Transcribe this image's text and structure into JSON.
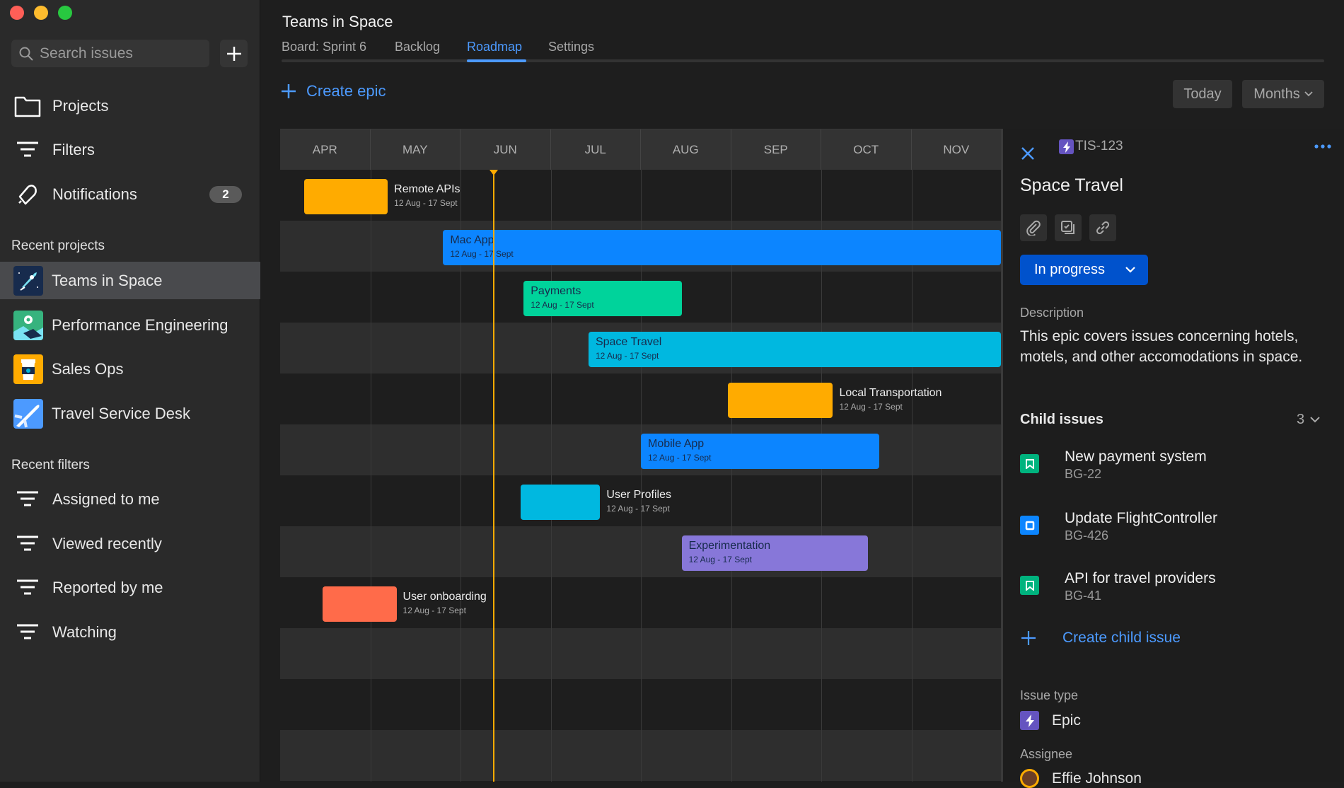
{
  "window": {
    "controls": [
      "close",
      "minimize",
      "maximize"
    ]
  },
  "sidebar": {
    "search_placeholder": "Search issues",
    "nav": [
      {
        "label": "Projects",
        "icon": "folder-icon"
      },
      {
        "label": "Filters",
        "icon": "filter-icon"
      },
      {
        "label": "Notifications",
        "icon": "bell-icon",
        "badge": "2"
      }
    ],
    "recent_projects_heading": "Recent projects",
    "projects": [
      {
        "label": "Teams in Space",
        "color": "#172b4d",
        "selected": true
      },
      {
        "label": "Performance Engineering",
        "color": "#36b37e"
      },
      {
        "label": "Sales Ops",
        "color": "#ffab00"
      },
      {
        "label": "Travel Service Desk",
        "color": "#4c9aff"
      }
    ],
    "recent_filters_heading": "Recent filters",
    "filters": [
      {
        "label": "Assigned to me"
      },
      {
        "label": "Viewed recently"
      },
      {
        "label": "Reported by me"
      },
      {
        "label": "Watching"
      }
    ]
  },
  "header": {
    "title": "Teams in Space",
    "tabs": [
      {
        "label": "Board: Sprint 6"
      },
      {
        "label": "Backlog"
      },
      {
        "label": "Roadmap",
        "active": true
      },
      {
        "label": "Settings"
      }
    ],
    "create_epic": "Create epic",
    "today": "Today",
    "scale": "Months"
  },
  "roadmap": {
    "months": [
      "APR",
      "MAY",
      "JUN",
      "JUL",
      "AUG",
      "SEP",
      "OCT",
      "NOV"
    ],
    "today": "06-12",
    "epics": [
      {
        "name": "Remote APIs",
        "dates": "12 Aug - 17 Sept",
        "start": "04-09",
        "end": "05-07",
        "color": "#ffab00",
        "label_outside": true
      },
      {
        "name": "Mac App",
        "dates": "12 Aug - 17 Sept",
        "start": "05-26",
        "end": "12-31",
        "color": "#0c85ff",
        "label_outside": false
      },
      {
        "name": "Payments",
        "dates": "12 Aug - 17 Sept",
        "start": "06-22",
        "end": "08-15",
        "color": "#00d39b",
        "label_outside": false
      },
      {
        "name": "Space Travel",
        "dates": "12 Aug - 17 Sept",
        "start": "07-14",
        "end": "12-31",
        "color": "#00b8e0",
        "label_outside": false
      },
      {
        "name": "Local Transportation",
        "dates": "12 Aug - 17 Sept",
        "start": "08-31",
        "end": "10-05",
        "color": "#ffab00",
        "label_outside": true
      },
      {
        "name": "Mobile App",
        "dates": "12 Aug - 17 Sept",
        "start": "08-01",
        "end": "10-21",
        "color": "#0c85ff",
        "label_outside": false
      },
      {
        "name": "User Profiles",
        "dates": "12 Aug - 17 Sept",
        "start": "06-21",
        "end": "07-18",
        "color": "#00b8e0",
        "label_outside": true
      },
      {
        "name": "Experimentation",
        "dates": "12 Aug - 17 Sept",
        "start": "08-15",
        "end": "10-17",
        "color": "#8777d9",
        "label_outside": false
      },
      {
        "name": "User onboarding",
        "dates": "12 Aug - 17 Sept",
        "start": "04-15",
        "end": "05-10",
        "color": "#ff6b4a",
        "label_outside": true
      }
    ]
  },
  "panel": {
    "key": "TIS-123",
    "title": "Space Travel",
    "status": "In progress",
    "description_label": "Description",
    "description": "This epic covers issues concerning hotels, motels, and other accomodations in space.",
    "child_issues_label": "Child issues",
    "child_count": "3",
    "children": [
      {
        "title": "New payment system",
        "key": "BG-22",
        "type": "story",
        "color": "#00b37e"
      },
      {
        "title": "Update FlightController",
        "key": "BG-426",
        "type": "task",
        "color": "#0c85ff"
      },
      {
        "title": "API for travel providers",
        "key": "BG-41",
        "type": "story",
        "color": "#00b37e"
      }
    ],
    "create_child": "Create child issue",
    "issue_type_label": "Issue type",
    "issue_type": "Epic",
    "epic_color": "#6554c0",
    "assignee_label": "Assignee",
    "assignee": "Effie Johnson"
  }
}
